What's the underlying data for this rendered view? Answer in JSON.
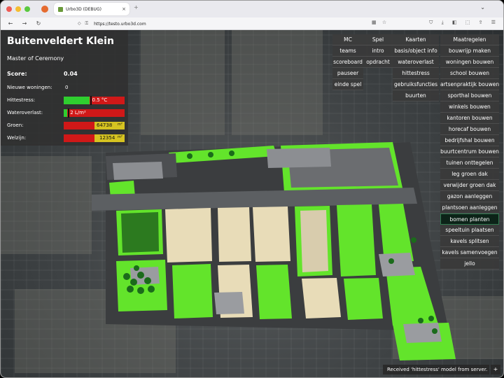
{
  "browser": {
    "tab_title": "Urbo3D (DEBUG)",
    "tab_close": "×",
    "new_tab": "+",
    "url": "https://testo.urbo3d.com",
    "nav_back": "←",
    "nav_forward": "→",
    "nav_reload": "↻",
    "tabs_menu": "⌄"
  },
  "info": {
    "title": "Buitenveldert Klein",
    "role": "Master of Ceremony",
    "score_label": "Score:",
    "score_value": "0.04",
    "new_homes_label": "Nieuwe woningen:",
    "new_homes_value": "0",
    "heat_label": "Hittestress:",
    "heat_value": "0.5 °C",
    "heat_fill": 0.42,
    "water_label": "Wateroverlast:",
    "water_value": "2 L/m²",
    "water_fill": 0.06,
    "green_label": "Groen:",
    "green_value": "64738",
    "green_unit": "m²",
    "welfare_label": "Welzijn:",
    "welfare_value": "12354",
    "welfare_unit": "m²"
  },
  "menu": {
    "col1": [
      "MC",
      "teams",
      "scoreboard",
      "pauseer",
      "einde spel"
    ],
    "col2": [
      "Spel",
      "intro",
      "opdracht"
    ],
    "col3": [
      "Kaarten",
      "basis/object info",
      "wateroverlast",
      "hittestress",
      "gebruiksfuncties",
      "buurten"
    ],
    "col4": [
      "Maatregelen",
      "bouwrijp maken",
      "woningen bouwen",
      "school bouwen",
      "artsenpraktijk bouwen",
      "sporthal bouwen",
      "winkels bouwen",
      "kantoren bouwen",
      "horecaf bouwen",
      "bedrijfshal bouwen",
      "buurtcentrum bouwen",
      "tuinen onttegelen",
      "leg groen dak",
      "verwijder groen dak",
      "gazon aanleggen",
      "plantsoen aanleggen",
      "bomen planten",
      "speeltuin plaatsen",
      "kavels splitsen",
      "kavels samenvoegen",
      "jello"
    ],
    "selected": "bomen planten"
  },
  "status": {
    "message": "Received 'hittestress' model from server.",
    "toggle": "+"
  },
  "colors": {
    "bar_red": "#d01818",
    "bar_green": "#2fce2f",
    "bar_yellow": "#d6c321",
    "green_area": "#63e42b"
  }
}
